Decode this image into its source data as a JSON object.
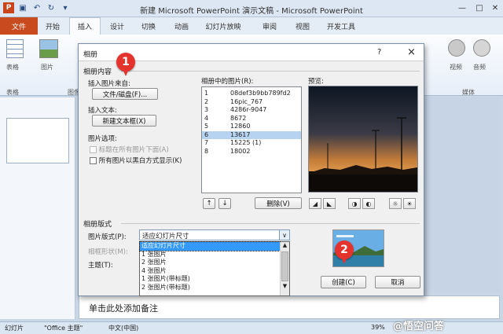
{
  "window": {
    "title": "新建 Microsoft PowerPoint 演示文稿 - Microsoft PowerPoint"
  },
  "ribbon": {
    "tabs": [
      "文件",
      "开始",
      "插入",
      "设计",
      "切换",
      "动画",
      "幻灯片放映",
      "审阅",
      "视图",
      "开发工具"
    ],
    "active_tab": "插入",
    "left_labels": {
      "table": "表格",
      "image": "图片",
      "group_table": "表格",
      "group_image": "图像"
    },
    "right_labels": {
      "video": "视频",
      "audio": "音频",
      "group_media": "媒体"
    }
  },
  "notes": {
    "placeholder": "单击此处添加备注"
  },
  "status": {
    "slide": "幻灯片",
    "theme": "\"Office 主题\"",
    "language": "中文(中国)",
    "zoom": "39%",
    "watermark": "@悟空问答"
  },
  "dialog": {
    "title": "相册",
    "help": "?",
    "close": "×",
    "section_content": "相册内容",
    "insert_from_label": "插入图片来自:",
    "file_disk_button": "文件/磁盘(F)...",
    "insert_text_label": "插入文本:",
    "new_textbox_button": "新建文本框(X)",
    "picture_options_label": "图片选项:",
    "option_caption": "标题在所有图片下面(A)",
    "option_bw": "所有图片以黑白方式显示(K)",
    "pictures_label": "相册中的图片(R):",
    "pictures": [
      {
        "num": "1",
        "name": "08def3b9bb789fd2"
      },
      {
        "num": "2",
        "name": "16pic_767"
      },
      {
        "num": "3",
        "name": "4286r-9047"
      },
      {
        "num": "4",
        "name": "8672"
      },
      {
        "num": "5",
        "name": "12860"
      },
      {
        "num": "6",
        "name": "13617",
        "selected": true
      },
      {
        "num": "7",
        "name": "15225 (1)"
      },
      {
        "num": "8",
        "name": "18002"
      }
    ],
    "preview_label": "预览:",
    "move_up": "↑",
    "move_down": "↓",
    "delete_button": "删除(V)",
    "section_layout": "相册版式",
    "layout_label": "图片版式(P):",
    "layout_value": "适应幻灯片尺寸",
    "frame_label": "相框形状(M):",
    "theme_label": "主题(T):",
    "layout_options": [
      "适应幻灯片尺寸",
      "1 张图片",
      "2 张图片",
      "4 张图片",
      "1 张图片(带标题)",
      "2 张图片(带标题)"
    ],
    "create_button": "创建(C)",
    "cancel_button": "取消",
    "markers": [
      "1",
      "2"
    ]
  }
}
